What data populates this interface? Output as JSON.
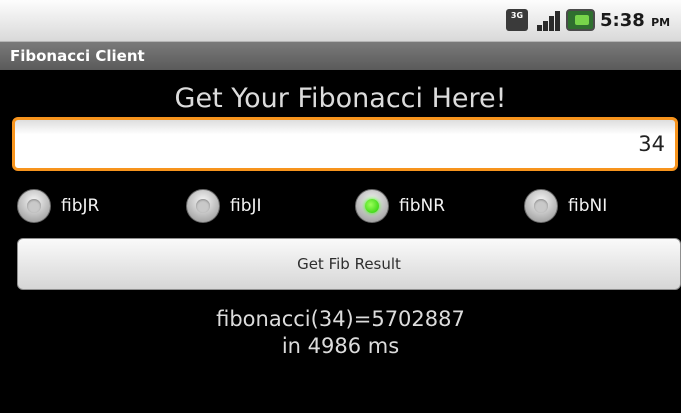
{
  "status_bar": {
    "network_label": "3G",
    "time": "5:38",
    "ampm": "PM",
    "icons": [
      "network-3g-icon",
      "signal-strength-icon",
      "battery-icon"
    ]
  },
  "app": {
    "title": "Fibonacci Client",
    "heading": "Get Your Fibonacci Here!"
  },
  "input": {
    "value": "34"
  },
  "radios": [
    {
      "label": "fibJR",
      "checked": false
    },
    {
      "label": "fibJI",
      "checked": false
    },
    {
      "label": "fibNR",
      "checked": true
    },
    {
      "label": "fibNI",
      "checked": false
    }
  ],
  "button": {
    "label": "Get Fib Result"
  },
  "result": {
    "line1": "fibonacci(34)=5702887",
    "line2": "in 4986 ms"
  },
  "colors": {
    "accent_focus": "#f7941d",
    "radio_checked": "#1fcb00",
    "background": "#000000"
  }
}
